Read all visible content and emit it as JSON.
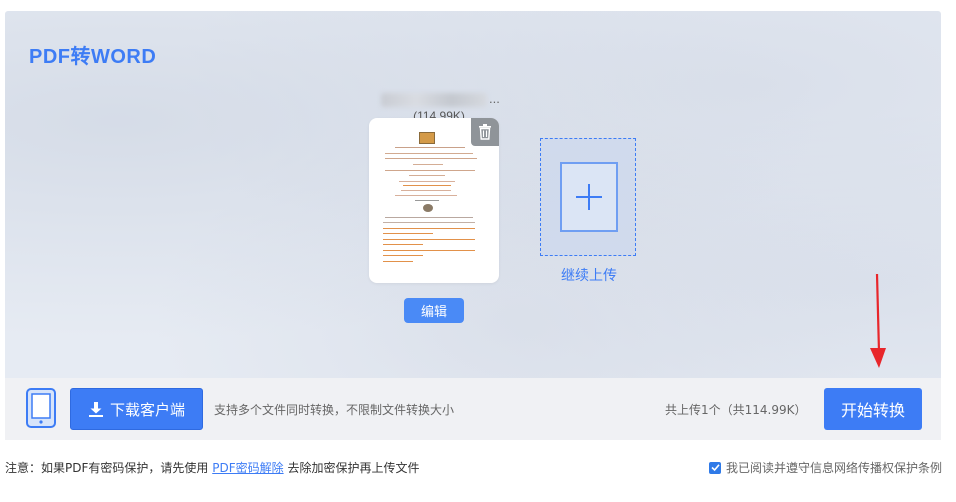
{
  "header": {
    "title": "PDF转WORD"
  },
  "file": {
    "name_suffix": "...",
    "size": "(114.99K)",
    "edit_label": "编辑"
  },
  "upload_more": {
    "label": "继续上传"
  },
  "bottom_bar": {
    "download_label": "下载客户端",
    "support_text": "支持多个文件同时转换，不限制文件转换大小",
    "total_text": "共上传1个（共114.99K）",
    "start_label": "开始转换"
  },
  "notice": {
    "prefix": "注意：如果PDF有密码保护，请先使用",
    "link": "PDF密码解除",
    "suffix": "去除加密保护再上传文件"
  },
  "agreement": {
    "label": "我已阅读并遵守信息网络传播权保护条例",
    "checked": true
  },
  "colors": {
    "accent": "#3d7cf5",
    "arrow": "#e8262b",
    "panel_bg": "#e6ebf3"
  }
}
